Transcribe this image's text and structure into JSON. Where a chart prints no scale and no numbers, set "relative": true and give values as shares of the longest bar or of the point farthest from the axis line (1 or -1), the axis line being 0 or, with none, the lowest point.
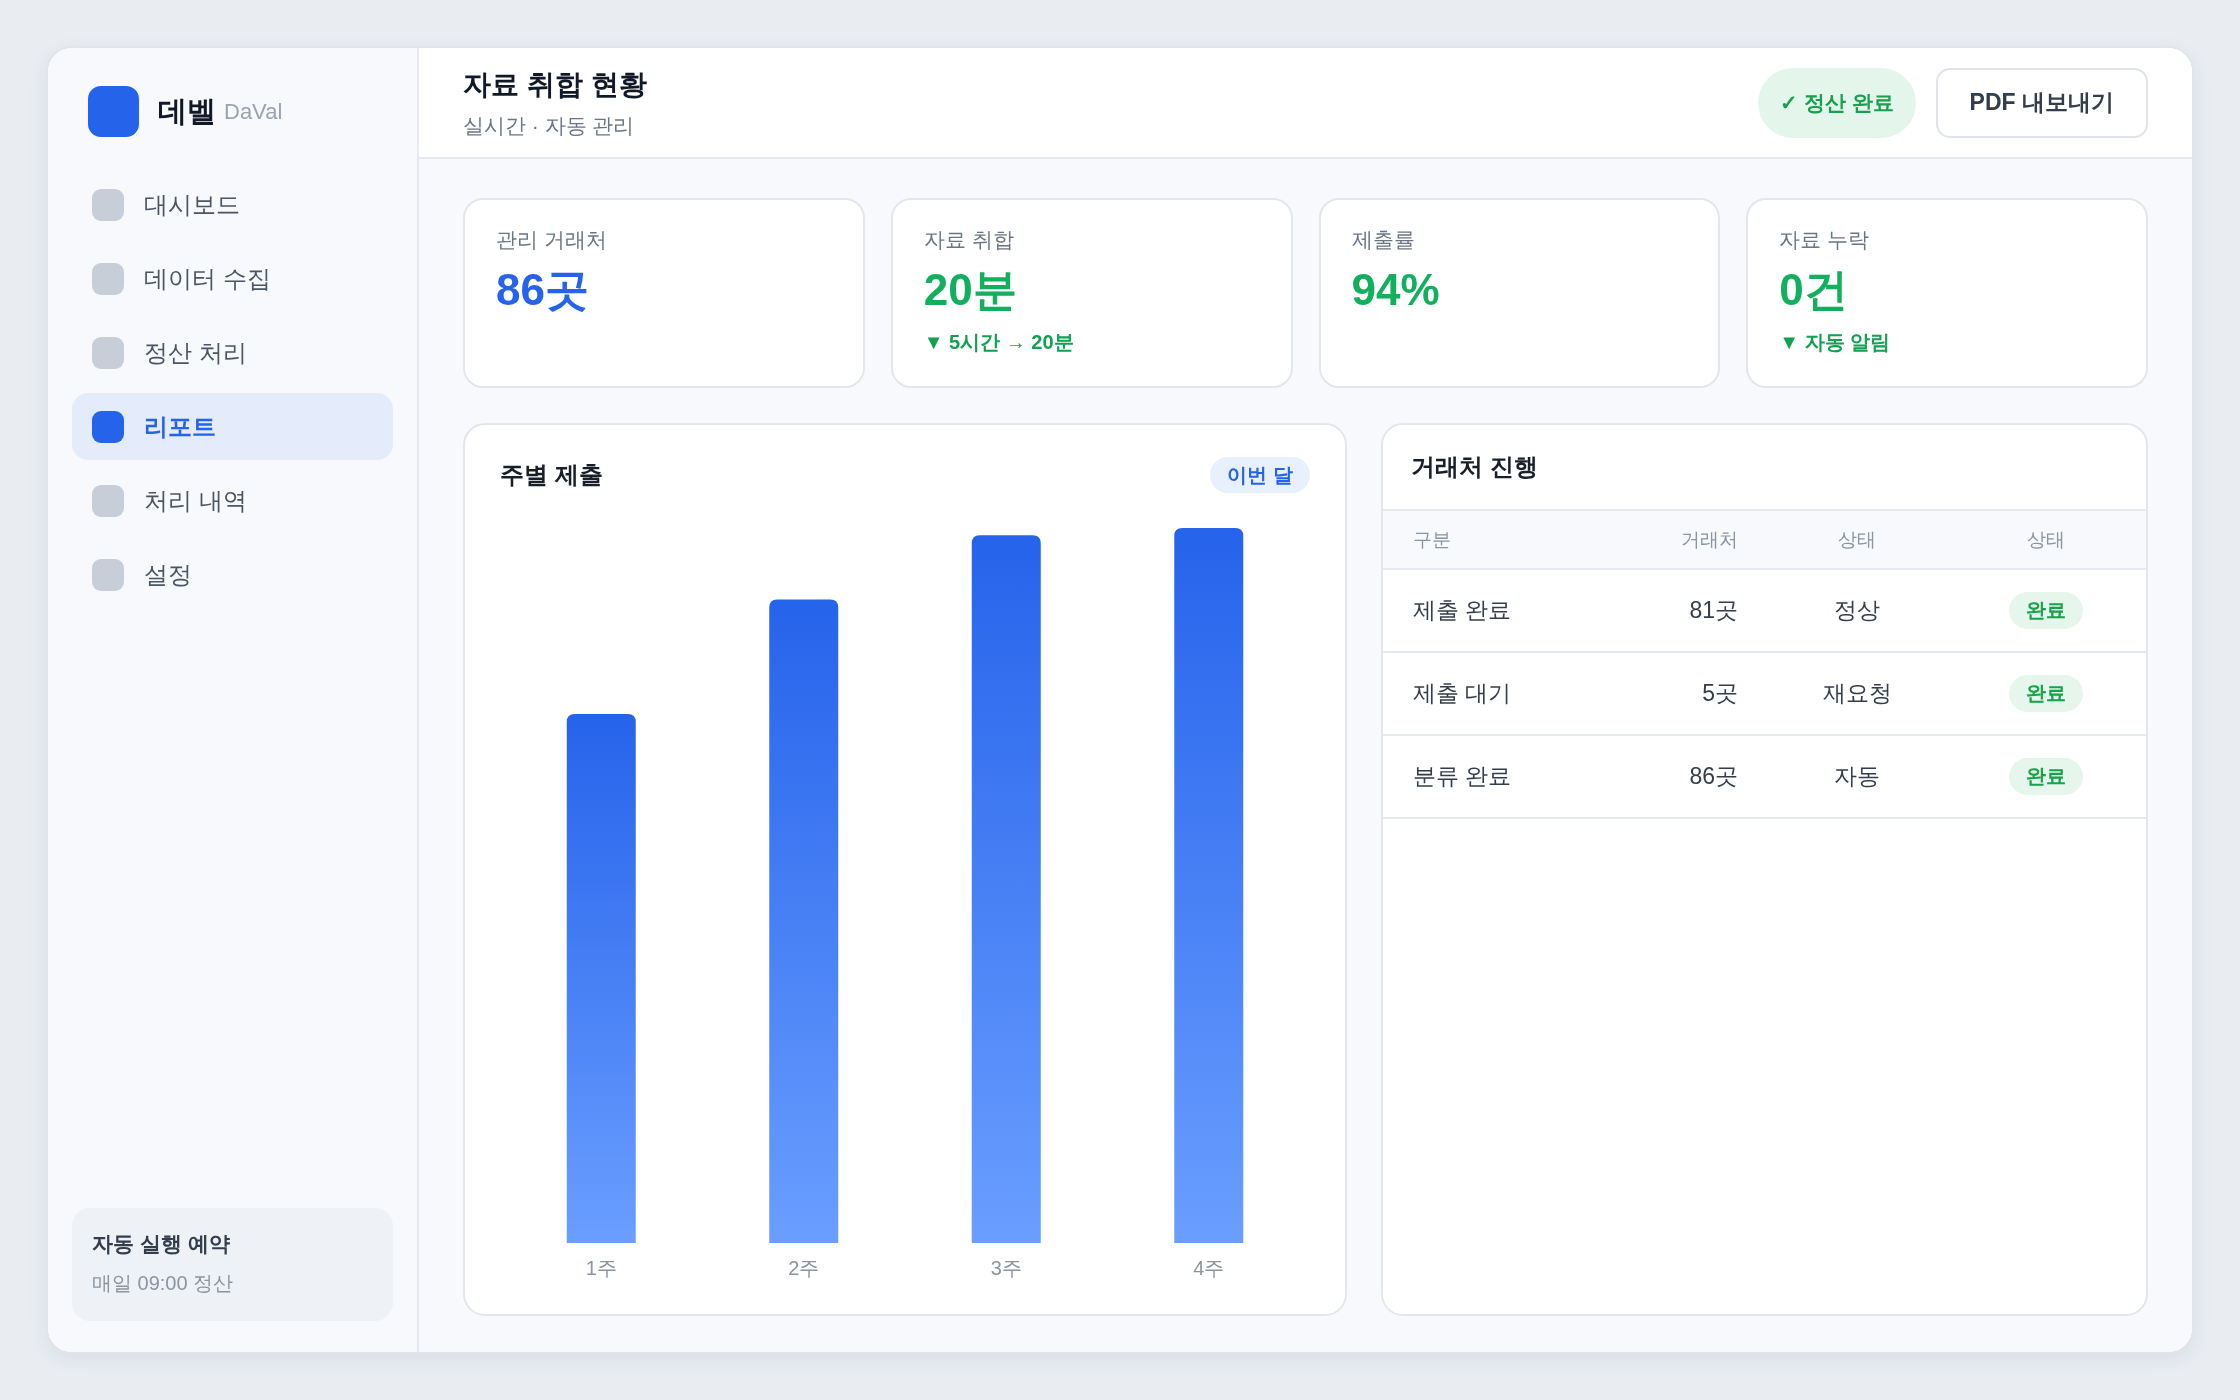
{
  "sidebar": {
    "brand": {
      "name": "데벨",
      "sub": "DaVal"
    },
    "items": [
      {
        "label": "대시보드",
        "selected": false
      },
      {
        "label": "데이터 수집",
        "selected": false
      },
      {
        "label": "정산 처리",
        "selected": false
      },
      {
        "label": "리포트",
        "selected": true
      },
      {
        "label": "처리 내역",
        "selected": false
      },
      {
        "label": "설정",
        "selected": false
      }
    ],
    "schedule": {
      "title": "자동 실행 예약",
      "detail": "매일 09:00 정산"
    }
  },
  "header": {
    "title": "자료 취합 현황",
    "subtitle": "실시간 · 자동 관리",
    "status_pill": "✓ 정산 완료",
    "export_button": "PDF 내보내기"
  },
  "kpis": [
    {
      "label": "관리 거래처",
      "value": "86곳",
      "color": "#2563eb"
    },
    {
      "label": "자료 취합",
      "value": "20분",
      "color": "#12b05e",
      "note": "▼ 5시간 → 20분"
    },
    {
      "label": "제출률",
      "value": "94%",
      "color": "#12b05e"
    },
    {
      "label": "자료 누락",
      "value": "0건",
      "color": "#12b05e",
      "note": "▼ 자동 알림"
    }
  ],
  "chart_card": {
    "badge": "이번 달",
    "chart_data": {
      "type": "bar",
      "title": "주별 제출",
      "categories": [
        "1주",
        "2주",
        "3주",
        "4주"
      ],
      "values": [
        0.74,
        0.9,
        0.99,
        1
      ],
      "relative": true
    }
  },
  "table_card": {
    "title": "거래처 진행",
    "columns": [
      "구분",
      "거래처",
      "상태",
      "상태"
    ],
    "rows": [
      {
        "category": "제출 완료",
        "count": "81곳",
        "status": "정상",
        "badge": "완료"
      },
      {
        "category": "제출 대기",
        "count": "5곳",
        "status": "재요청",
        "badge": "완료"
      },
      {
        "category": "분류 완료",
        "count": "86곳",
        "status": "자동",
        "badge": "완료"
      }
    ]
  }
}
